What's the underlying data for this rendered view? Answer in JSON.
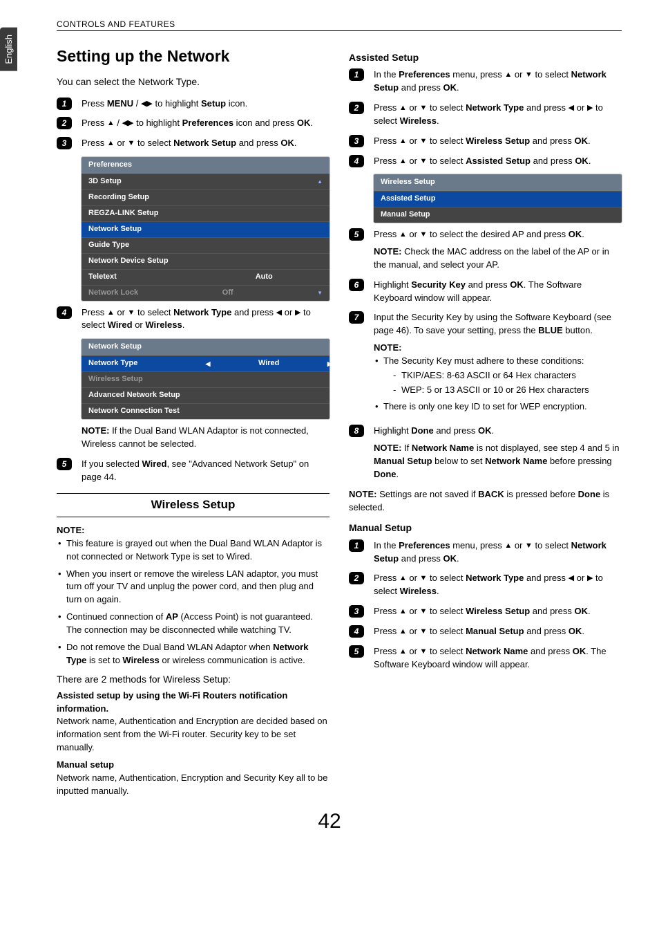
{
  "header": {
    "section": "CONTROLS AND FEATURES",
    "language": "English"
  },
  "page_number": "42",
  "left": {
    "title": "Setting up the Network",
    "intro": "You can select the Network Type.",
    "step1_a": "Press ",
    "step1_b": "MENU",
    "step1_c": " / ",
    "step1_d": " to highlight ",
    "step1_e": "Setup",
    "step1_f": " icon.",
    "step2_a": "Press ",
    "step2_b": " / ",
    "step2_c": " to highlight ",
    "step2_d": "Preferences",
    "step2_e": " icon and press ",
    "step2_f": "OK",
    "step2_g": ".",
    "step3_a": "Press ",
    "step3_b": " or ",
    "step3_c": " to select ",
    "step3_d": "Network Setup",
    "step3_e": " and press ",
    "step3_f": "OK",
    "step3_g": ".",
    "menu1": {
      "title": "Preferences",
      "rows": [
        {
          "label": "3D Setup",
          "val": ""
        },
        {
          "label": "Recording Setup",
          "val": ""
        },
        {
          "label": "REGZA-LINK Setup",
          "val": ""
        },
        {
          "label": "Network Setup",
          "val": "",
          "sel": true
        },
        {
          "label": "Guide Type",
          "val": ""
        },
        {
          "label": "Network Device Setup",
          "val": ""
        },
        {
          "label": "Teletext",
          "val": "Auto"
        },
        {
          "label": "Network Lock",
          "val": "Off",
          "dis": true
        }
      ]
    },
    "step4_a": "Press ",
    "step4_b": " or ",
    "step4_c": " to select ",
    "step4_d": "Network Type",
    "step4_e": " and press ",
    "step4_f": " or ",
    "step4_g": " to select ",
    "step4_h": "Wired",
    "step4_i": " or ",
    "step4_j": "Wireless",
    "step4_k": ".",
    "menu2": {
      "title": "Network Setup",
      "rows": [
        {
          "label": "Network Type",
          "val": "Wired",
          "sel": true,
          "arrows": true
        },
        {
          "label": "Wireless Setup",
          "val": "",
          "dis": true
        },
        {
          "label": "Advanced Network Setup",
          "val": ""
        },
        {
          "label": "Network Connection Test",
          "val": ""
        }
      ]
    },
    "note1_a": "NOTE:",
    "note1_b": " If the Dual Band WLAN Adaptor is not connected, Wireless cannot be selected.",
    "step5_a": "If you selected ",
    "step5_b": "Wired",
    "step5_c": ", see \"Advanced Network Setup\" on page 44.",
    "wireless_heading": "Wireless Setup",
    "wnote_label": "NOTE:",
    "wnote_items": [
      "This feature is grayed out when the Dual Band WLAN Adaptor is not connected or Network Type is set to Wired.",
      "When you insert or remove the wireless LAN adaptor, you must turn off your TV and unplug the power cord, and then plug and turn on again."
    ],
    "wnote_item3_a": "Continued connection of ",
    "wnote_item3_b": "AP",
    "wnote_item3_c": " (Access Point) is not guaranteed. The connection may be disconnected while watching TV.",
    "wnote_item4_a": "Do not remove the Dual Band WLAN Adaptor when ",
    "wnote_item4_b": "Network Type",
    "wnote_item4_c": " is set to ",
    "wnote_item4_d": "Wireless",
    "wnote_item4_e": " or wireless communication is active.",
    "methods_intro": "There are 2 methods for Wireless Setup:",
    "assisted_title": "Assisted setup by using the Wi-Fi Routers notification information.",
    "assisted_body": "Network name, Authentication and Encryption are decided based on information sent from the Wi-Fi router. Security key to be set manually.",
    "manual_title": "Manual setup",
    "manual_body": "Network name, Authentication, Encryption and Security Key all to be inputted manually."
  },
  "right": {
    "assisted_heading": "Assisted Setup",
    "a1_a": "In the ",
    "a1_b": "Preferences",
    "a1_c": " menu, press ",
    "a1_d": " or ",
    "a1_e": " to select ",
    "a1_f": "Network Setup",
    "a1_g": " and press ",
    "a1_h": "OK",
    "a1_i": ".",
    "a2_a": "Press ",
    "a2_b": " or ",
    "a2_c": " to select ",
    "a2_d": "Network Type",
    "a2_e": " and press ",
    "a2_f": " or ",
    "a2_g": " to select ",
    "a2_h": "Wireless",
    "a2_i": ".",
    "a3_a": "Press ",
    "a3_b": " or ",
    "a3_c": " to select ",
    "a3_d": "Wireless Setup",
    "a3_e": " and press ",
    "a3_f": "OK",
    "a3_g": ".",
    "a4_a": "Press ",
    "a4_b": " or ",
    "a4_c": " to select ",
    "a4_d": "Assisted Setup",
    "a4_e": " and press ",
    "a4_f": "OK",
    "a4_g": ".",
    "menu3": {
      "title": "Wireless Setup",
      "rows": [
        {
          "label": "Assisted Setup",
          "val": "",
          "sel": true
        },
        {
          "label": "Manual Setup",
          "val": ""
        }
      ]
    },
    "a5_a": "Press ",
    "a5_b": " or ",
    "a5_c": " to select the desired AP and press ",
    "a5_d": "OK",
    "a5_e": ".",
    "a5_note_a": "NOTE:",
    "a5_note_b": " Check the MAC address on the label of the AP or in the manual, and select your AP.",
    "a6_a": "Highlight ",
    "a6_b": "Security Key",
    "a6_c": " and press ",
    "a6_d": "OK",
    "a6_e": ". The Software Keyboard window will appear.",
    "a7_a": "Input the Security Key by using the Software Keyboard (see page 46). To save your setting, press the ",
    "a7_b": "BLUE",
    "a7_c": " button.",
    "a7_note_label": "NOTE:",
    "a7_note_item1": "The Security Key must adhere to these conditions:",
    "a7_note_sub1": "TKIP/AES: 8-63 ASCII or 64 Hex characters",
    "a7_note_sub2": "WEP: 5 or 13 ASCII or 10 or 26 Hex characters",
    "a7_note_item2": "There is only one key ID to set for WEP encryption.",
    "a8_a": "Highlight ",
    "a8_b": "Done",
    "a8_c": " and press ",
    "a8_d": "OK",
    "a8_e": ".",
    "a8_note_a": "NOTE:",
    "a8_note_b": " If ",
    "a8_note_c": "Network Name",
    "a8_note_d": " is not displayed, see step 4 and 5 in ",
    "a8_note_e": "Manual Setup",
    "a8_note_f": " below to set ",
    "a8_note_g": "Network Name",
    "a8_note_h": " before pressing ",
    "a8_note_i": "Done",
    "a8_note_j": ".",
    "final_note_a": "NOTE:",
    "final_note_b": " Settings are not saved if ",
    "final_note_c": "BACK",
    "final_note_d": " is pressed before ",
    "final_note_e": "Done",
    "final_note_f": " is selected.",
    "manual_heading": "Manual Setup",
    "m1_a": "In the ",
    "m1_b": "Preferences",
    "m1_c": " menu, press ",
    "m1_d": " or ",
    "m1_e": " to select ",
    "m1_f": "Network Setup",
    "m1_g": " and press ",
    "m1_h": "OK",
    "m1_i": ".",
    "m2_a": "Press ",
    "m2_b": " or ",
    "m2_c": " to select ",
    "m2_d": "Network Type",
    "m2_e": " and press ",
    "m2_f": " or ",
    "m2_g": " to select ",
    "m2_h": "Wireless",
    "m2_i": ".",
    "m3_a": "Press ",
    "m3_b": " or ",
    "m3_c": " to select ",
    "m3_d": "Wireless Setup",
    "m3_e": " and press ",
    "m3_f": "OK",
    "m3_g": ".",
    "m4_a": "Press ",
    "m4_b": " or ",
    "m4_c": " to select ",
    "m4_d": "Manual Setup",
    "m4_e": " and press ",
    "m4_f": "OK",
    "m4_g": ".",
    "m5_a": "Press ",
    "m5_b": " or ",
    "m5_c": " to select ",
    "m5_d": "Network Name",
    "m5_e": " and press ",
    "m5_f": "OK",
    "m5_g": ". The Software Keyboard window will appear."
  }
}
